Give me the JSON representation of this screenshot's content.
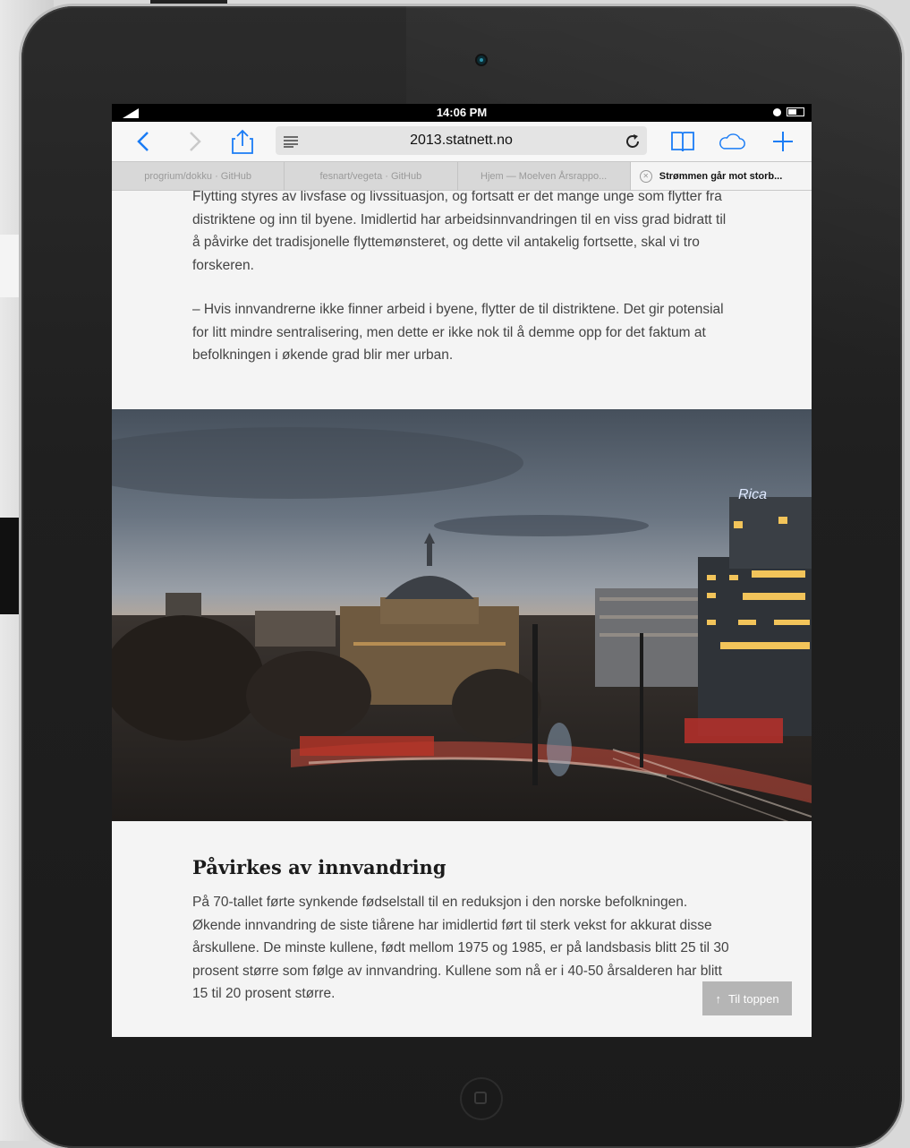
{
  "status": {
    "time": "14:06 PM"
  },
  "toolbar": {
    "url": "2013.statnett.no",
    "icons": [
      "back-chevron-icon",
      "forward-chevron-icon",
      "share-icon",
      "reader-icon",
      "reload-icon",
      "bookmarks-icon",
      "icloud-tabs-icon",
      "new-tab-icon"
    ]
  },
  "tabs": [
    {
      "label": "progrium/dokku · GitHub"
    },
    {
      "label": "fesnart/vegeta · GitHub"
    },
    {
      "label": "Hjem — Moelven Årsrappo..."
    },
    {
      "label": "Strømmen går mot storb..."
    }
  ],
  "article": {
    "para1": "Flytting styres av livsfase og livssituasjon, og fortsatt er det mange unge som flytter fra distriktene og inn til byene. Imidlertid har arbeidsinnvandringen til en viss grad bidratt til å påvirke det tradisjonelle flyttemønsteret, og dette vil antakelig fortsette, skal vi tro forskeren.",
    "para2": "– Hvis innvandrerne ikke finner arbeid i byene, flytter de til distriktene. Det gir potensial for litt mindre sentralisering, men dette er ikke nok til å demme opp for det faktum at befolkningen i økende grad blir mer urban.",
    "heading": "Påvirkes av innvandring",
    "para3": "På 70-tallet førte synkende fødselstall til en reduksjon i den norske befolkningen. Økende innvandring de siste tiårene har imidlertid ført til sterk vekst for akkurat disse årskullene. De minste kullene, født mellom 1975 og 1985, er på landsbasis blitt 25 til 30 prosent større som følge av innvandring. Kullene som nå er i 40-50 årsalderen har blitt 15 til 20 prosent større.",
    "photo_sign": "Rica"
  },
  "totop": {
    "label": "Til toppen",
    "arrow": "↑"
  }
}
